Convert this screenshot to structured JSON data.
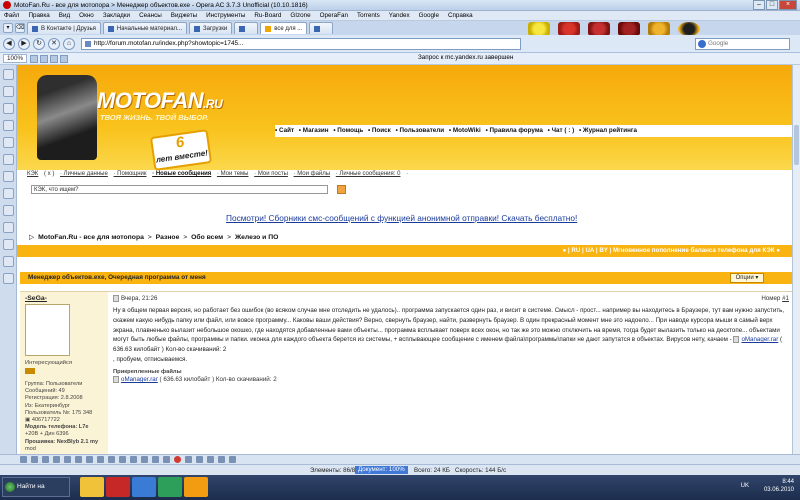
{
  "window": {
    "title": "MotoFan.Ru - все для мотопора > Менеджер объектов.exe - Opera AC 3.7.3 Unofficial (10.10.1816)"
  },
  "menu": [
    "Файл",
    "Правка",
    "Вид",
    "Окно",
    "Закладки",
    "Сеансы",
    "Виджеты",
    "Инструменты",
    "Ru-Board",
    "GIzone",
    "OperaFan",
    "Torrents",
    "Yandex",
    "Google",
    "Справка"
  ],
  "tabs": [
    {
      "label": "В Контакте | Друзья"
    },
    {
      "label": "Начальные материал..."
    },
    {
      "label": "Загрузки"
    },
    {
      "label": ""
    },
    {
      "label": "все для ..."
    },
    {
      "label": ""
    }
  ],
  "address": {
    "url": "http://forum.motofan.ru/index.php?showtopic=1745...",
    "search_placeholder": "Google"
  },
  "toolbar2": {
    "zoom": "100%",
    "status_msg": "Запрос к mc.yandex.ru завершен"
  },
  "banner": {
    "logo": "MOTOFAN",
    "logo_suffix": ".RU",
    "slogan": "ТВОЯ ЖИЗНЬ. ТВОЙ ВЫБОР.",
    "anniv_num": "6",
    "anniv_text": "лет вместе!",
    "nav": [
      "• Сайт",
      "• Магазин",
      "• Помощь",
      "• Поиск",
      "• Пользователи",
      "• MotoWiki",
      "• Правила форума",
      "• Чат ( : )",
      "• Журнал рейтинга"
    ]
  },
  "userbar": {
    "items": [
      {
        "text": "КЭК",
        "cls": "link"
      },
      {
        "text": "( x )",
        "cls": ""
      },
      {
        "text": "· Личные данные",
        "cls": "link"
      },
      {
        "text": "· Помощник",
        "cls": "link"
      },
      {
        "text": "· Новые сообщения",
        "cls": "bold link"
      },
      {
        "text": "· Мои темы",
        "cls": "link"
      },
      {
        "text": "· Мои посты",
        "cls": "link"
      },
      {
        "text": "· Мои файлы",
        "cls": "link"
      },
      {
        "text": "· Личные сообщения: 0",
        "cls": "link"
      },
      {
        "text": "·",
        "cls": ""
      }
    ],
    "search_value": "КЭК, что ищем?"
  },
  "advert": "Посмотри! Сборники смс-сообщений с функцией анонимной отправки! Скачать бесплатно!",
  "breadcrumbs": [
    "MotoFan.Ru - все для мотопора",
    "Разное",
    "Обо всем",
    "Железо и ПО"
  ],
  "orange_bar": {
    "links": "● | RU | UA | BY | Мгновенное пополнение баланса телефона для КЭК ●"
  },
  "topic": {
    "title": "Менеджер объектов.exe, Очередная программа от меня",
    "options": "Опции ▾"
  },
  "post": {
    "nick": "-SeGa-",
    "rank": "Интересующийся",
    "stat_lines": [
      "Группа: Пользователи",
      "Сообщений: 49",
      "Регистрация: 2.8.2008",
      "Из: Екатеринбург",
      "Пользователь №: 175 348",
      "▣ 406717722",
      "Модель телефона: L7e",
      "+20B + Дин 6396",
      "Прошивка: NexBlyb 2.1 my",
      "mod"
    ],
    "date": "Вчера, 21:26",
    "num_label": "Номер",
    "num": "#1",
    "body_1": "Ну в общем первая версия, но работает без ошибок (во всяком случае мне отследить не удалось).. программа запускается один раз, и висит в системе. Смысл - прост... например вы находитесь в Браузере, тут вам нужно запустить, скажем какую нибудь папку или файл, или вовсе программу... Каковы ваши действия? Верно, свернуть браузер, найти, развернуть браузер. В один прекрасный момент мне это надоело... При наводе курсора мыши в самый верх экрана, плавненько вылазит небольшое окошко, где находятся добавленные вами объекты... программа всплывает поверх всех окон, но так же это можно отключить на время, тогда будет вылазить только на десктопе... объектами могут быть любые файлы, программы и папки. иконка для каждого объекта берется из системы, + всплывающее сообщение с именем файла\\программы\\папки не дают запутатся в объектах. Вирусов нету, качаем -",
    "body_att": "oManager.rar",
    "body_2": "( 636.63 килобайт ) Кол-во скачиваний: 2",
    "body_3": ", пробуем, отписываемся.",
    "attach_title": "Прикрепленные файлы",
    "attach_name": "oManager.rar",
    "attach_info": "( 636.63 килобайт ) Кол-во скачиваний: 2"
  },
  "statusbar": {
    "elements": "Элементы: 86/86",
    "zoom": "Документ: 100%",
    "total": "Всего: 24 КБ",
    "speed": "Скорость: 144 Б/с"
  },
  "taskbar": {
    "start": "Найти на странице",
    "lang": "UK",
    "time": "8:44",
    "date": "03.06.2010"
  }
}
